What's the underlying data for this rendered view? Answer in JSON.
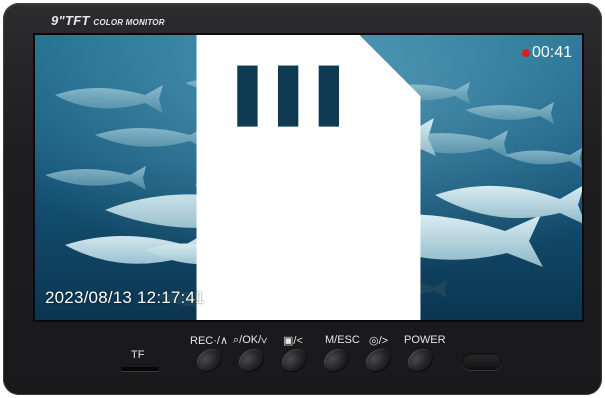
{
  "device": {
    "brand_prefix": "9\"TFT",
    "brand_suffix": "COLOR MONITOR"
  },
  "overlay": {
    "rec_time": "00:41",
    "timestamp": "2023/08/13  12:17:41",
    "rec_color": "#e11d1d"
  },
  "controls": {
    "tf_label": "TF",
    "buttons": [
      {
        "label": "REC·/∧"
      },
      {
        "label": "⌕/OK/∨"
      },
      {
        "label": "▣/<"
      },
      {
        "label": "M/ESC"
      },
      {
        "label": "◎/>"
      },
      {
        "label": "POWER"
      }
    ]
  },
  "icons": [
    "sd-card-icon",
    "record-dot-icon"
  ]
}
